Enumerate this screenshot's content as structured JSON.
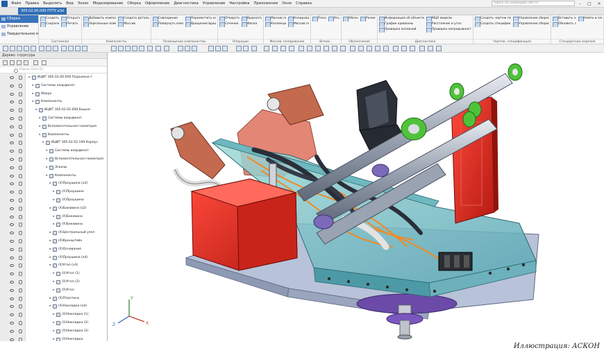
{
  "menubar": {
    "items": [
      "Файл",
      "Правка",
      "Выделить",
      "Вид",
      "Эскиз",
      "Моделирование",
      "Сборка",
      "Оформление",
      "Диагностика",
      "Управление",
      "Настройка",
      "Приложения",
      "Окно",
      "Справка"
    ],
    "search_placeholder": "Поиск по командам (Alt+/)"
  },
  "tabbar": {
    "active_tab": "305.02.00.000 ПТТУ.a3d"
  },
  "ribbon": {
    "modes": [
      "Сборка",
      "Управление",
      "Твердотельное моделирование"
    ],
    "groups": [
      {
        "name": "Системная",
        "commands": [
          "Создать",
          "Открыть",
          "Сохранить",
          "Печать"
        ]
      },
      {
        "name": "Компоненты",
        "commands": [
          "Добавить компонент из...",
          "Создать деталь",
          "Зеркальные компоненты",
          "Массив"
        ]
      },
      {
        "name": "Размещение компонентов",
        "commands": [
          "Совпадение",
          "Переместить компонент",
          "Повернуть компонент",
          "Вращение-вращение"
        ]
      },
      {
        "name": "Операции",
        "commands": [
          "Отверстие простое",
          "Вырезать выдавливанием",
          "Сечение",
          "Фаска"
        ]
      },
      {
        "name": "Массив, копирование",
        "commands": [
          "Массив по сетке",
          "Копировать объекты",
          "Коллекция геометрии",
          "Массив по концентрической"
        ]
      },
      {
        "name": "Вспом...",
        "commands": [
          "Плоскость",
          "Ось"
        ]
      },
      {
        "name": "Обозначения",
        "commands": [
          "Обозначения",
          "Размер"
        ]
      },
      {
        "name": "Диагностика",
        "commands": [
          "Информация об объекте",
          "МЦХ модели",
          "График кривизны",
          "Расстояние и угол",
          "Проверка коллизий",
          "Проверка непрерывности"
        ]
      },
      {
        "name": "Чертеж, спецификация",
        "commands": [
          "Создать чертеж по модели",
          "Управление сборкой",
          "Создать спецификацию",
          "Управление сборкой по модели"
        ]
      },
      {
        "name": "Стандартные изделия",
        "commands": [
          "Вставить элемент",
          "Найти и заменить",
          "Обновить ссылки на моде..."
        ]
      }
    ]
  },
  "tree": {
    "title": "Дерево: структура",
    "search_placeholder": "Поиск (Ctrl+F)",
    "rows": [
      {
        "level": 0,
        "label": "ИЦИТ 305.02.00.000 Подъемно-т"
      },
      {
        "level": 1,
        "label": "Системы координат"
      },
      {
        "level": 1,
        "label": "Макро"
      },
      {
        "level": 1,
        "label": "Компоненты"
      },
      {
        "level": 2,
        "label": "ИЦИТ 305.02.02.000 Башня"
      },
      {
        "level": 3,
        "label": "Системы координат"
      },
      {
        "level": 3,
        "label": "Вспомогательная геометрия"
      },
      {
        "level": 3,
        "label": "Компоненты"
      },
      {
        "level": 4,
        "label": "ИЦИТ 305.02.02.100 Корпус"
      },
      {
        "level": 5,
        "label": "Системы координат"
      },
      {
        "level": 5,
        "label": "Вспомогательная геометрия"
      },
      {
        "level": 5,
        "label": "Эскизы"
      },
      {
        "level": 5,
        "label": "Компоненты"
      },
      {
        "level": 6,
        "label": "(Х)Проушина (х2)"
      },
      {
        "level": 7,
        "label": "(Х)Проушина"
      },
      {
        "level": 7,
        "label": "(Х)Проушина"
      },
      {
        "level": 6,
        "label": "(Х)Боковина (х2)"
      },
      {
        "level": 7,
        "label": "(Х)Боковина"
      },
      {
        "level": 7,
        "label": "(Х)Боковина"
      },
      {
        "level": 6,
        "label": "(Х)Центральный узел"
      },
      {
        "level": 6,
        "label": "(Х)Кронштейн"
      },
      {
        "level": 6,
        "label": "(Х)Основание"
      },
      {
        "level": 6,
        "label": "(Х)Проушина (х4)"
      },
      {
        "level": 6,
        "label": "(Х)Угол (х3)"
      },
      {
        "level": 7,
        "label": "(Х)Угол (1)"
      },
      {
        "level": 7,
        "label": "(Х)Угол (2)"
      },
      {
        "level": 7,
        "label": "(Х)Угол"
      },
      {
        "level": 6,
        "label": "(Х)Пластина"
      },
      {
        "level": 6,
        "label": "(Х)Накладка (х4)"
      },
      {
        "level": 7,
        "label": "(Х)Накладка (1)"
      },
      {
        "level": 7,
        "label": "(Х)Накладка (2)"
      },
      {
        "level": 7,
        "label": "(Х)Накладка (3)"
      },
      {
        "level": 7,
        "label": "(Х)Накладка"
      }
    ]
  },
  "viewport": {
    "axes": {
      "x": "X",
      "y": "Y",
      "z": "Z"
    }
  },
  "caption": "Иллюстрация: АСКОН",
  "colors": {
    "accent": "#2f6db5",
    "red_part": "#d42a1f",
    "glass": "#7fc7c9",
    "bracket": "#c46a4e",
    "green_ring": "#4fc23a",
    "base_plate": "#b8c2d8"
  }
}
